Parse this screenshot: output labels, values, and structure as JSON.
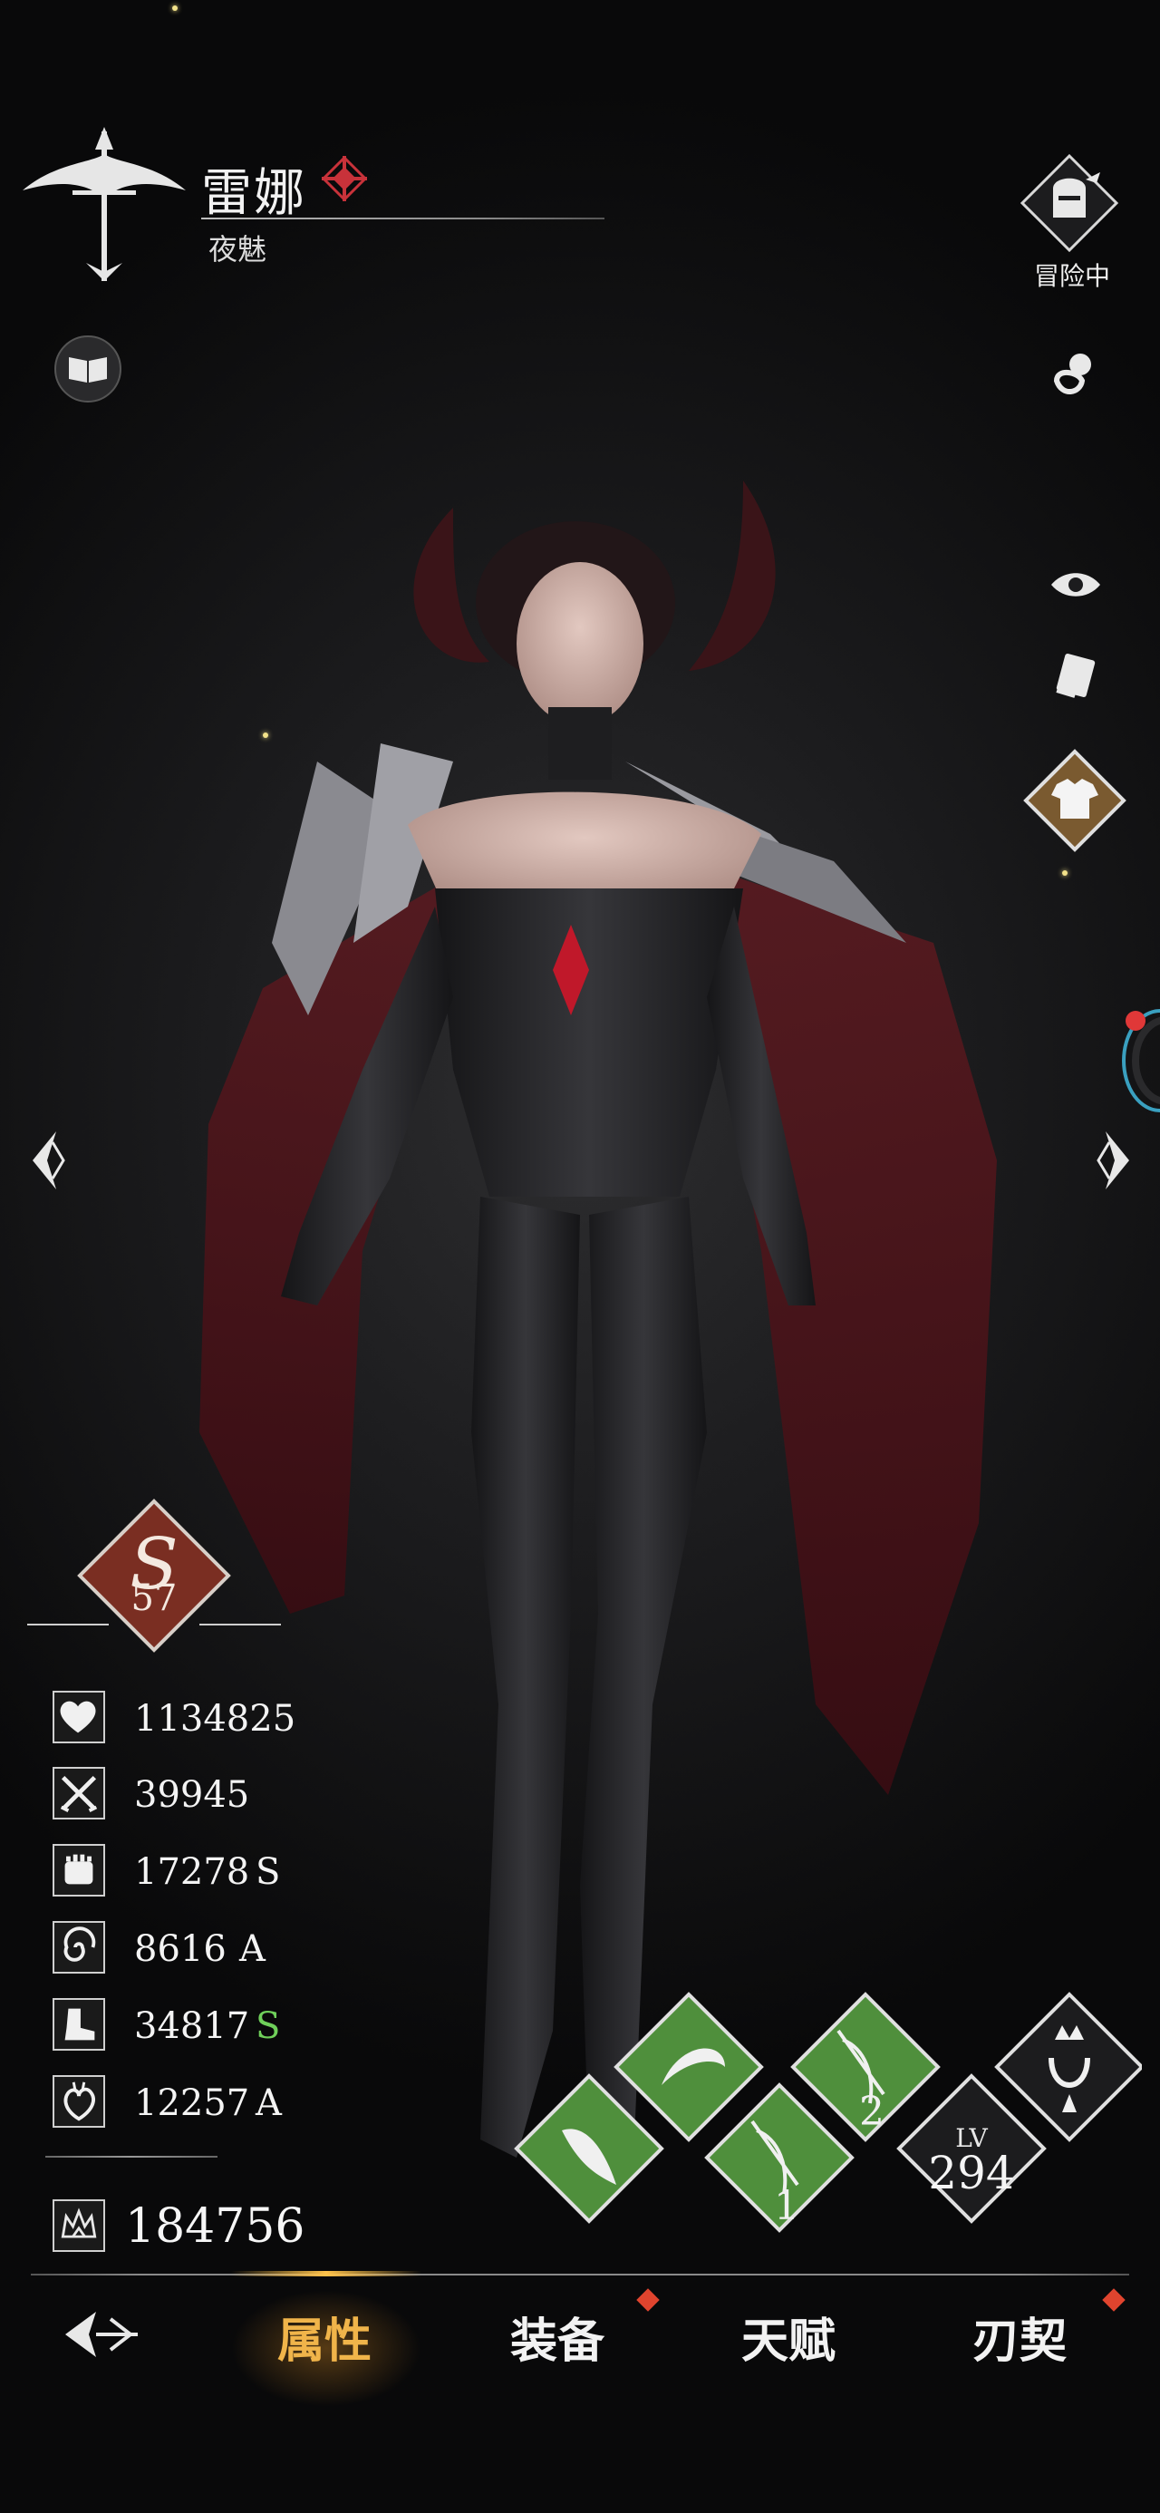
{
  "header": {
    "name": "雷娜",
    "title": "夜魅",
    "status_label": "冒险中"
  },
  "rank": {
    "grade_letter": "S",
    "level": "57"
  },
  "stats": [
    {
      "icon": "heart-icon",
      "value": "1134825",
      "grade": ""
    },
    {
      "icon": "crossed-swords-icon",
      "value": "39945",
      "grade": ""
    },
    {
      "icon": "fist-icon",
      "value": "17278",
      "grade": "S",
      "grade_color": "#f4f4f4"
    },
    {
      "icon": "vortex-icon",
      "value": "8616",
      "grade": "A",
      "grade_color": "#f4f4f4"
    },
    {
      "icon": "boot-icon",
      "value": "34817",
      "grade": "S",
      "grade_color": "#6fcf5a"
    },
    {
      "icon": "heart-organ-icon",
      "value": "12257",
      "grade": "A",
      "grade_color": "#f4f4f4"
    }
  ],
  "power": {
    "icon": "crown-icon",
    "value": "184756"
  },
  "skills": {
    "lv_label": "LV",
    "lv_value": "294",
    "skill_numbers": [
      "1",
      "2"
    ]
  },
  "nav": {
    "tabs": [
      {
        "id": "attributes",
        "label": "属性",
        "active": true
      },
      {
        "id": "equipment",
        "label": "装备",
        "badge": true
      },
      {
        "id": "talent",
        "label": "天赋"
      },
      {
        "id": "bond",
        "label": "刃契",
        "badge": true
      }
    ]
  },
  "colors": {
    "accent_gold": "#f0b44a",
    "skill_green": "#4f8f3c",
    "rank_red": "#7a2e22",
    "badge_red": "#e0442e"
  }
}
